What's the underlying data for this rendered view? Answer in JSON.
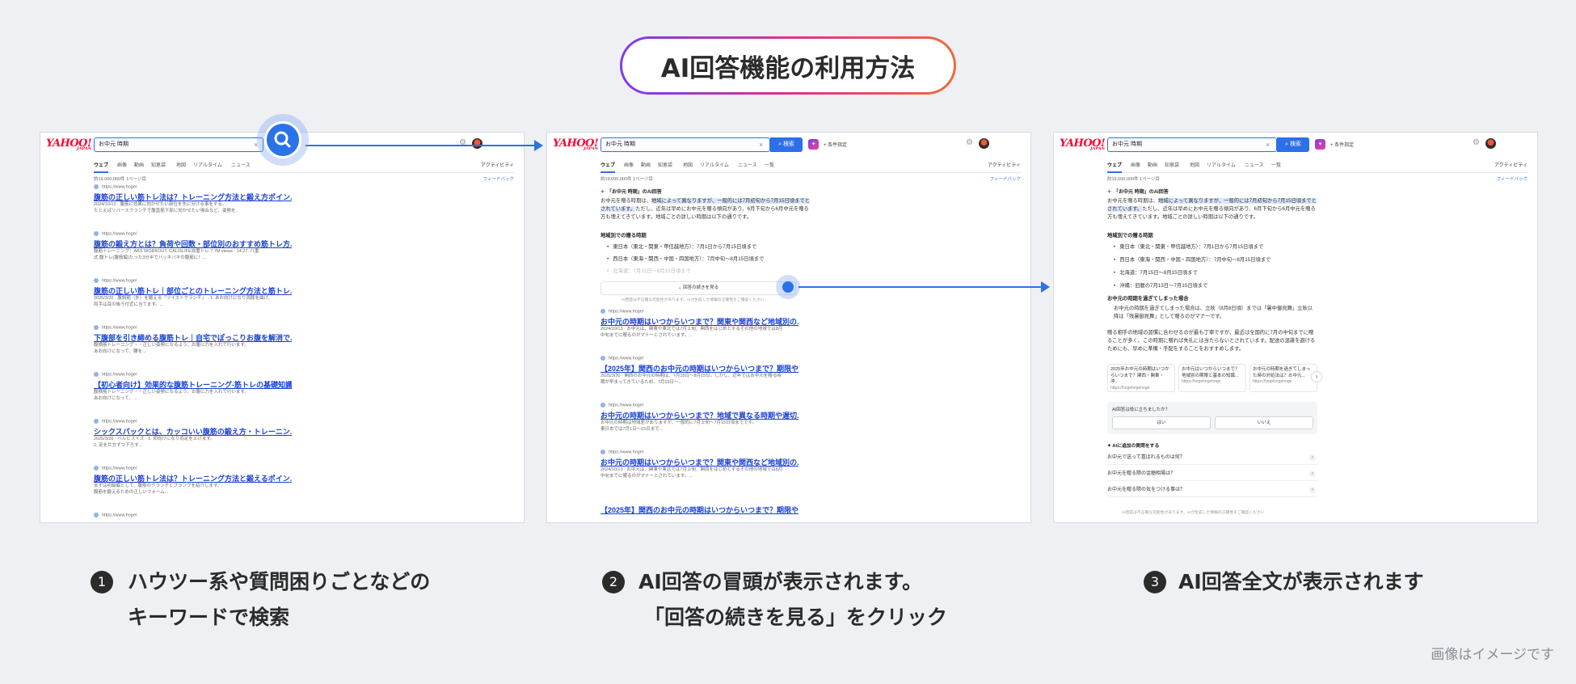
{
  "header": {
    "title": "AI回答機能の利用方法"
  },
  "search": {
    "query": "お中元 時期",
    "button_label": "検索",
    "condition_label": "条件指定",
    "result_count": "約19,000,000件 1ページ目",
    "feedback": "フィードバック",
    "tabs": [
      "ウェブ",
      "画像",
      "動画",
      "知恵袋",
      "地図",
      "リアルタイム",
      "ニュース",
      "一覧"
    ],
    "tabs_right": "アクティビティ"
  },
  "panel1": {
    "results": [
      {
        "url": "https://www.hoge/",
        "title": "腹筋の正しい筋トレ法は？トレーニング方法と鍛え方ポイン...",
        "snippet1": "2024/10/13 · 腹筋に効果に効かせたい部位を先に分ける事をする。",
        "snippet2": "たとえばリバースクランチで腹直筋下部に効かせたい場合など、姿勢を..."
      },
      {
        "url": "https://www.hoge/",
        "title": "腹筋の鍛え方とは？負荷や回数・部位別のおすすめ筋トレ方...",
        "snippet1": "腹筋トレーニング：ABS WORKOUT. CALISLIFE自重トレ 7.7M views · 14:27. 八重",
        "snippet2": "式 腹トレ(腹筋編)たった3分半でバッキバキの腹筋に！..."
      },
      {
        "url": "https://www.hoge/",
        "title": "腹筋の正しい筋トレ｜部位ごとのトレーニング方法と筋トレ...",
        "snippet1": "2025/3/20 · 腹斜筋（外）を鍛える「ツイストクランチ」 · 1. あお向けになり両膝を曲げ、",
        "snippet2": "両手は耳の後ろ付近に当てます。..."
      },
      {
        "url": "https://www.hoge/",
        "title": "下腹部を引き締める腹筋トレ｜自宅でぽっこりお腹を解消で...",
        "snippet1": "腹横筋トレーニング・・正しい姿勢になるよう、お腹に力を入れて行います。",
        "snippet2": "あお向けになって、腰を..."
      },
      {
        "url": "https://www.hoge/",
        "title": "【初心者向け】効果的な腹筋トレーニング-筋トレの基礎知識...",
        "snippet1": "腹横筋トレーニング・・正しい姿勢になるよう、お腹に力を入れて行います。",
        "snippet2": "あお向けになって、..."
      },
      {
        "url": "https://www.hoge/",
        "title": "シックスパックとは、カッコいい腹筋の鍛え方・トレーニン...",
        "snippet1": "2025/3/20 · ベルビスイズ · 1. 仰向けになり両足を上げます。",
        "snippet2": "2. 足を片方ずつ下ろす..."
      },
      {
        "url": "https://www.hoge/",
        "title": "腹筋の正しい筋トレ法は？トレーニング方法と鍛えるポイン...",
        "snippet1": "まずは初級編として、腹筋のクランチとプランクを紹介します。",
        "snippet2": "腹筋を鍛えるための正しいフォーム..."
      },
      {
        "url": "https://www.hoge/",
        "title": "",
        "snippet1": "",
        "snippet2": ""
      }
    ]
  },
  "ai": {
    "heading": "「お中元 時期」のAI回答",
    "intro_plain": "お中元を贈る時期は、",
    "intro_highlight": "地域によって異なりますが、一般的には7月初旬から7月15日頃までとされています。",
    "intro_rest": "ただし、近年は早めにお中元を贈る傾向があり、6月下旬から6月中元を贈る方も増えてきています。地域ごとの詳しい時期は以下の通りです。",
    "regions_title": "地域別での贈る時期",
    "regions": [
      "東日本（東北・関東・甲信越地方）：7月1日から7月15日頃まで",
      "西日本（東海・関西・中国・四国地方）：7月中旬〜8月15日頃まで",
      "北海道：7月15日〜8月15日頃まで",
      "沖縄：旧暦の7月13日〜7月15日頃まで"
    ],
    "more_button": "回答の続きを見る",
    "disclaimer": "AI回答は不正確な可能性があります。AIが生成した情報の正確性をご確認ください",
    "late_title": "お中元の時期を過ぎてしまった場合",
    "late_text": "お中元の時期を過ぎてしまった場合は、立秋（8月8日頃）までは「暑中御見舞」立秋以降は「残暑御見舞」として贈るのがマナーです。",
    "closing": "贈る相手の地域の習慣に合わせるのが最も丁寧ですが、最近は全国的に7月の中旬までに贈ることが多く、この時期に贈れば失礼には当たらないとされています。配送の混雑を避けるためにも、早めに準備・手配をすることをおすすめします。",
    "cards": [
      {
        "title": "2025年お中元の時期はいつからいつまで？関西・関東・沖...",
        "url": "https://hogehogehoge"
      },
      {
        "title": "お中元はいつからいつまで？地域別の期限と基本の知識...",
        "url": "https://hogehogehoge"
      },
      {
        "title": "お中元の時期を過ぎてしまった時の対処法は？お中元...",
        "url": "https://hogehogehoge"
      }
    ],
    "helpful_question": "AI回答は役に立ちましたか？",
    "yes": "はい",
    "no": "いいえ",
    "followup_title": "AIに追加の質問をする",
    "followups": [
      "お中元で送って喜ばれるものは何？",
      "お中元を贈る際の金額相場は？",
      "お中元を贈る際の気をつける事は？"
    ]
  },
  "panel2": {
    "results": [
      {
        "url": "https://www.hoge/",
        "title": "お中元の時期はいつからいつまで？関東や関西など地域別の...",
        "snippet1": "2024/10/13 · お中元は、関東や東北では7月上旬、関西をはじめとするその他の地域では8月",
        "snippet2": "中旬までに贈るのがマナーとされています。..."
      },
      {
        "url": "https://www.hoge/",
        "title": "【2025年】関西のお中元の時期はいつからいつまで？期限や...",
        "snippet1": "2025/3/20 · 関西のお中元の時期は、7月15日〜8月15日。しかし、近年ではお中元を贈る時",
        "snippet2": "期が早まってきているため、7月15日〜..."
      },
      {
        "url": "https://www.hoge/",
        "title": "お中元の時期はいつからいつまで？地域で異なる時期や遅切...",
        "snippet1": "お中元の時期は地域差がありますが、一般的に7月上旬〜7月15日頃までです。",
        "snippet2": "東日本では7月1日〜15日まで..."
      },
      {
        "url": "https://www.hoge/",
        "title": "お中元の時期はいつからいつまで？関東や関西など地域別の...",
        "snippet1": "2024/10/13 · お中元は、関東や東北では7月上旬、関西をはじめとするその他の地域では8月",
        "snippet2": "中旬までに贈るのがマナーとされています。..."
      },
      {
        "url": "",
        "title": "【2025年】関西のお中元の時期はいつからいつまで？期限や...",
        "snippet1": "",
        "snippet2": ""
      }
    ]
  },
  "steps": [
    {
      "num": "1",
      "line1": "ハウツー系や質問困りごとなどの",
      "line2": "キーワードで検索"
    },
    {
      "num": "2",
      "line1": "AI回答の冒頭が表示されます。",
      "line2": "「回答の続きを見る」をクリック"
    },
    {
      "num": "3",
      "line1": "AI回答全文が表示されます",
      "line2": ""
    }
  ],
  "footer_note": "画像はイメージです",
  "colors": {
    "accent": "#2a72e8",
    "link": "#1a3fd4",
    "yahoo_red": "#ff0033",
    "background": "#eef0f3"
  },
  "icons": [
    "search-icon",
    "clear-icon",
    "gear-icon",
    "avatar",
    "ai-assistant-icon",
    "chevron-right-icon",
    "sparkle-icon"
  ]
}
